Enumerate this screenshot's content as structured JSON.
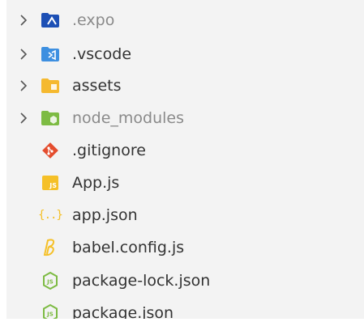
{
  "items": [
    {
      "label": ".expo",
      "type": "folder",
      "icon": "expo-folder-icon",
      "color": "#1c4fb5",
      "dimmed": true
    },
    {
      "label": ".vscode",
      "type": "folder",
      "icon": "vscode-folder-icon",
      "color": "#3d8fe0",
      "dimmed": false
    },
    {
      "label": "assets",
      "type": "folder",
      "icon": "assets-folder-icon",
      "color": "#f5b92f",
      "dimmed": false
    },
    {
      "label": "node_modules",
      "type": "folder",
      "icon": "node-folder-icon",
      "color": "#7dbb43",
      "dimmed": true
    },
    {
      "label": ".gitignore",
      "type": "file",
      "icon": "git-icon",
      "color": "#e44d2e",
      "dimmed": false
    },
    {
      "label": "App.js",
      "type": "file",
      "icon": "js-icon",
      "color": "#f5c028",
      "dimmed": false
    },
    {
      "label": "app.json",
      "type": "file",
      "icon": "json-icon",
      "color": "#f5c028",
      "dimmed": false
    },
    {
      "label": "babel.config.js",
      "type": "file",
      "icon": "babel-icon",
      "color": "#f5c028",
      "dimmed": false
    },
    {
      "label": "package-lock.json",
      "type": "file",
      "icon": "nodejs-icon",
      "color": "#7dbb43",
      "dimmed": false
    },
    {
      "label": "package.json",
      "type": "file",
      "icon": "nodejs-icon",
      "color": "#7dbb43",
      "dimmed": false
    }
  ],
  "icons": {
    "js_badge": "JS",
    "json_glyph": "{..}"
  }
}
